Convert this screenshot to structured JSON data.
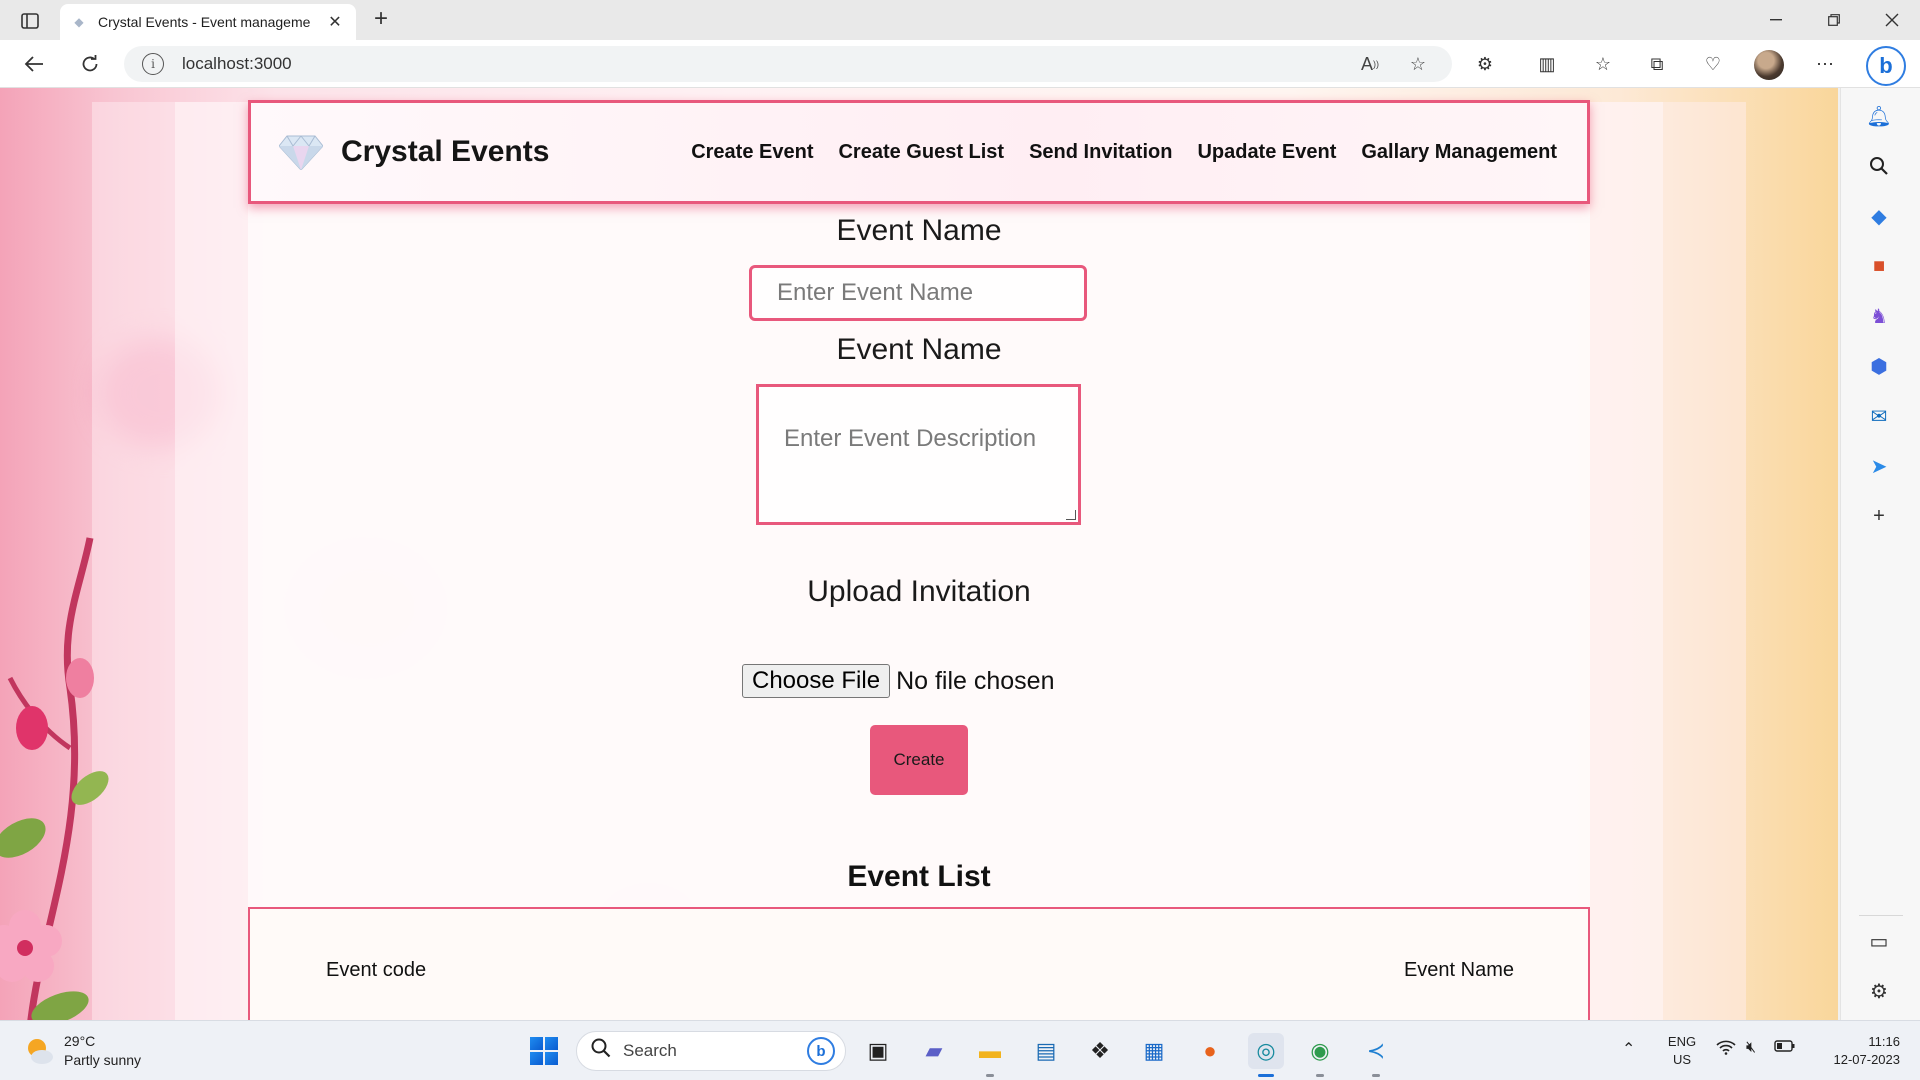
{
  "browser": {
    "tab_title": "Crystal Events - Event manageme",
    "url": "localhost:3000",
    "new_tab_label": "+",
    "close_tab_label": "✕"
  },
  "app": {
    "brand": "Crystal Events",
    "logo_icon": "diamond-icon",
    "nav": [
      "Create Event",
      "Create Guest List",
      "Send Invitation",
      "Upadate Event",
      "Gallary Management"
    ],
    "accent_color": "#e8587c"
  },
  "form": {
    "event_name_label": "Event Name",
    "event_name_placeholder": "Enter Event Name",
    "description_label": "Event Name",
    "description_placeholder": "Enter Event Description",
    "upload_label": "Upload Invitation",
    "file_button": "Choose File",
    "file_status": "No file chosen",
    "create_button": "Create"
  },
  "event_list": {
    "title": "Event List",
    "columns": [
      "Event code",
      "Event Name"
    ]
  },
  "taskbar": {
    "weather_temp": "29°C",
    "weather_desc": "Partly sunny",
    "search_placeholder": "Search",
    "lang_line1": "ENG",
    "lang_line2": "US",
    "time": "11:16",
    "date": "12-07-2023"
  }
}
